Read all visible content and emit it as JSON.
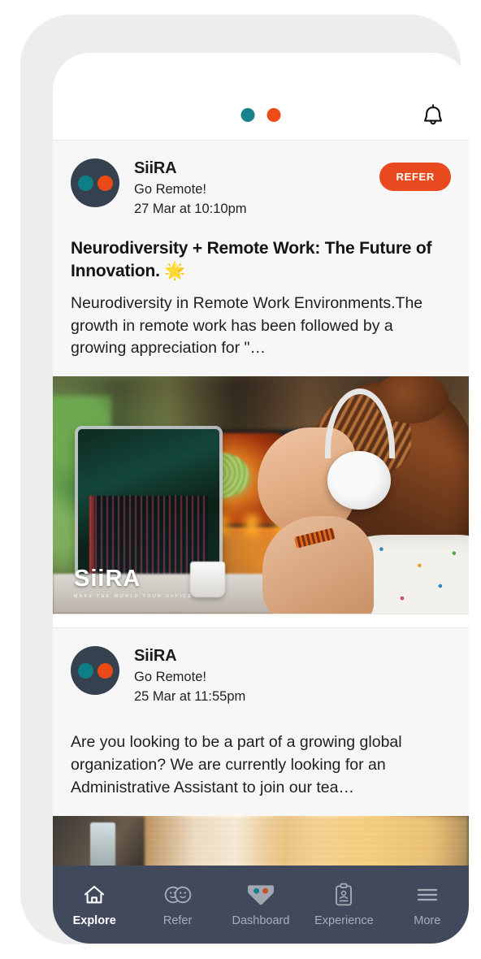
{
  "app": {
    "brand": "SiiRA",
    "header": {
      "logo_dot_teal": "#17828a",
      "logo_dot_orange": "#ec4a17",
      "notifications_icon": "bell-icon"
    }
  },
  "feed": {
    "posts": [
      {
        "author": "SiiRA",
        "tagline": "Go Remote!",
        "timestamp": "27 Mar at 10:10pm",
        "action_label": "REFER",
        "title": "Neurodiversity + Remote Work: The Future of Innovation. 🌟",
        "body": "Neurodiversity in Remote Work Environments.The growth in remote work has been followed by a growing appreciation for \"…",
        "media": {
          "alt": "Woman wearing headphones working at a desk with multiple monitors showing a brain graphic and data charts",
          "watermark_name": "SiiRA",
          "watermark_tagline": "MAKE THE WORLD YOUR OFFICE"
        }
      },
      {
        "author": "SiiRA",
        "tagline": "Go Remote!",
        "timestamp": "25 Mar at 11:55pm",
        "title": "",
        "body": "Are you looking to be a part of a growing global organization? We are currently looking for an Administrative Assistant to join our tea…",
        "media": {
          "alt": "Warm sunlit office scene with window blinds"
        }
      }
    ]
  },
  "bottom_nav": {
    "items": [
      {
        "label": "Explore",
        "icon": "home-icon",
        "active": true
      },
      {
        "label": "Refer",
        "icon": "two-faces-icon",
        "active": false
      },
      {
        "label": "Dashboard",
        "icon": "gem-icon",
        "active": false
      },
      {
        "label": "Experience",
        "icon": "clipboard-icon",
        "active": false
      },
      {
        "label": "More",
        "icon": "hamburger-icon",
        "active": false
      }
    ],
    "background": "#414a5c",
    "active_color": "#ffffff",
    "inactive_color": "#a8adb8"
  },
  "colors": {
    "accent_orange": "#e8491e",
    "accent_teal": "#0d8086",
    "avatar_navy": "#36414f",
    "card_bg": "#f7f7f7"
  }
}
